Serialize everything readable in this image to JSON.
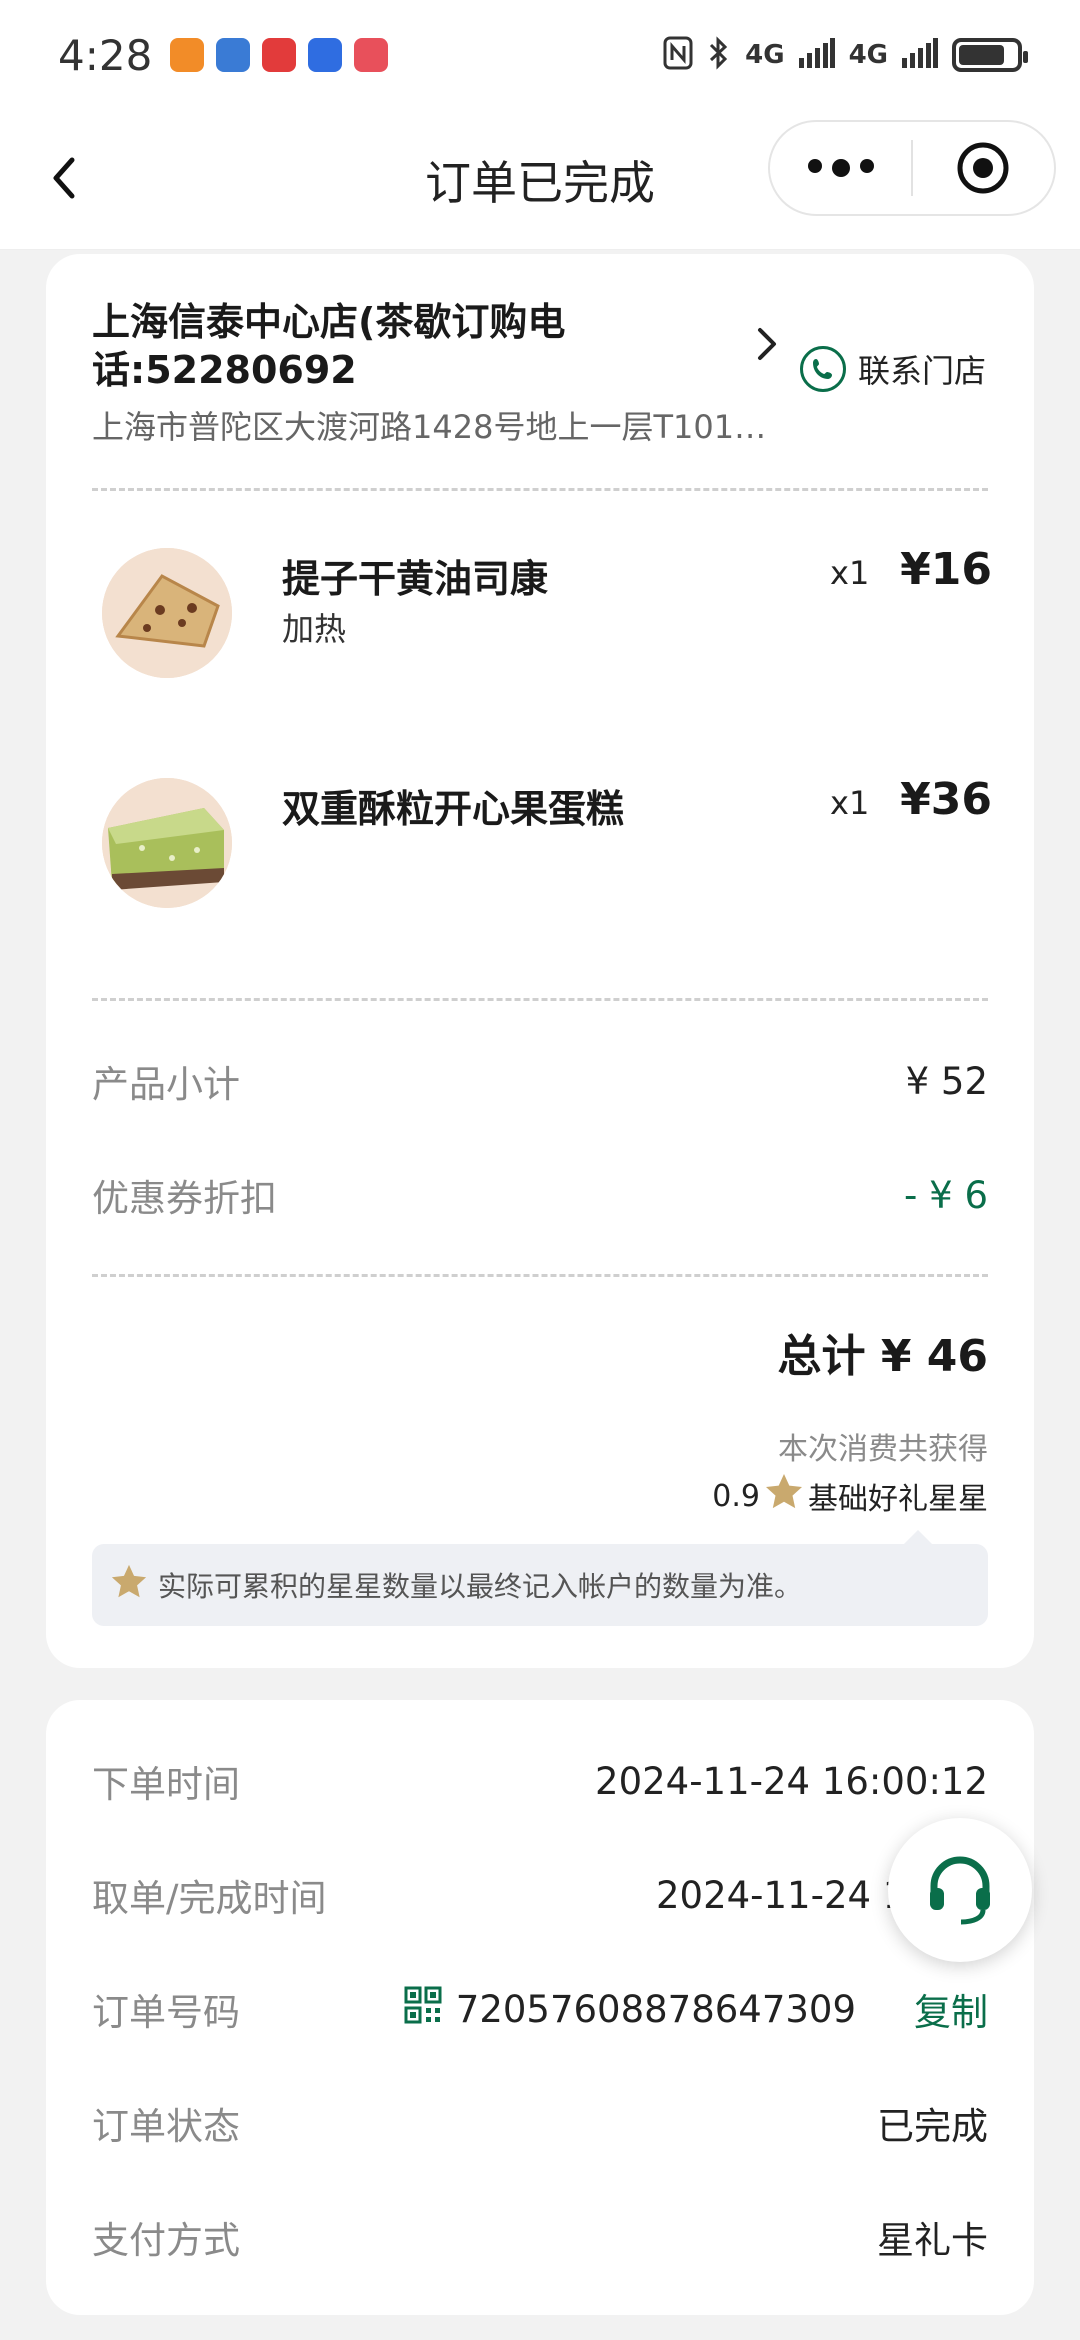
{
  "status_bar": {
    "time": "4:28",
    "network_1": "4G",
    "network_2": "4G"
  },
  "nav": {
    "title": "订单已完成"
  },
  "store": {
    "name": "上海信泰中心店(茶歇订购电话:52280692",
    "address": "上海市普陀区大渡河路1428号地上一层T101…",
    "contact_label": "联系门店"
  },
  "items": [
    {
      "name": "提子干黄油司康",
      "option": "加热",
      "qty": "x1",
      "price": "¥16"
    },
    {
      "name": "双重酥粒开心果蛋糕",
      "option": "",
      "qty": "x1",
      "price": "¥36"
    }
  ],
  "summary": {
    "subtotal_label": "产品小计",
    "subtotal_value": "¥ 52",
    "coupon_label": "优惠券折扣",
    "coupon_value": "- ¥ 6",
    "total": "总计 ¥ 46",
    "earn_label": "本次消费共获得",
    "stars_count": "0.9",
    "stars_label": "基础好礼星星",
    "tip": "实际可累积的星星数量以最终记入帐户的数量为准。"
  },
  "order_info": {
    "placed_label": "下单时间",
    "placed_value": "2024-11-24 16:00:12",
    "completed_label": "取单/完成时间",
    "completed_value": "2024-11-24 16:",
    "order_no_label": "订单号码",
    "order_no_value": "72057608878647309",
    "copy_label": "复制",
    "status_label": "订单状态",
    "status_value": "已完成",
    "payment_label": "支付方式",
    "payment_value": "星礼卡"
  },
  "colors": {
    "accent_green": "#0a6e4a",
    "star_gold": "#c9a96e"
  }
}
